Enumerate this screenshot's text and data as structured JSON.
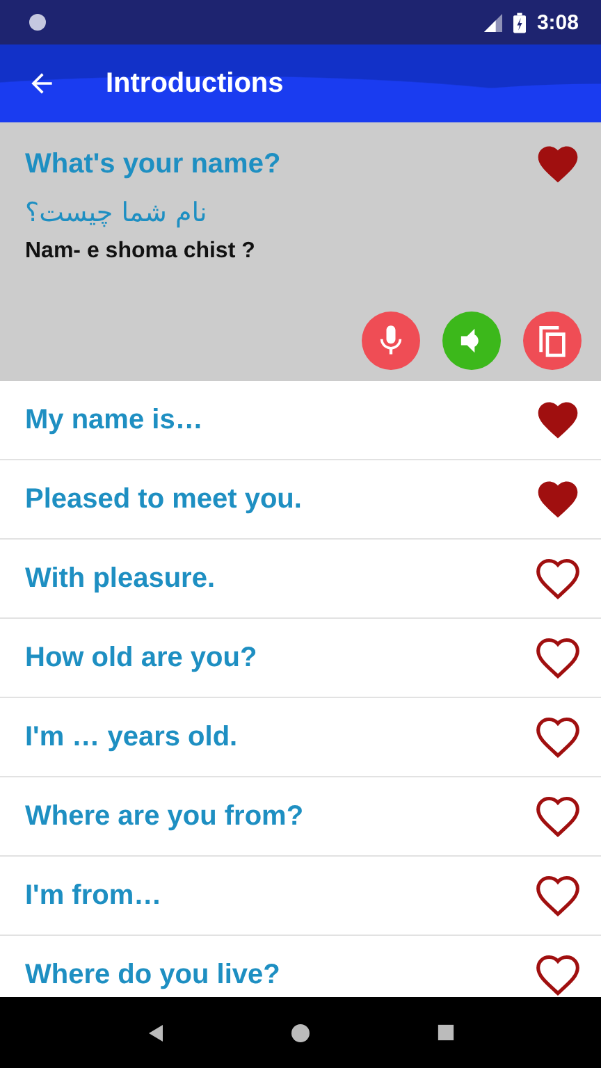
{
  "status_bar": {
    "time": "3:08"
  },
  "app_bar": {
    "title": "Introductions"
  },
  "expanded": {
    "phrase": "What's your name?",
    "translation": "نام شما چیست؟",
    "transliteration": "Nam- e shoma chist ?",
    "favorite": true
  },
  "phrases": [
    {
      "text": "My name is…",
      "favorite": true
    },
    {
      "text": "Pleased to meet you.",
      "favorite": true
    },
    {
      "text": "With pleasure.",
      "favorite": false
    },
    {
      "text": "How old are you?",
      "favorite": false
    },
    {
      "text": "I'm … years old.",
      "favorite": false
    },
    {
      "text": "Where are you from?",
      "favorite": false
    },
    {
      "text": "I'm from…",
      "favorite": false
    },
    {
      "text": "Where do you live?",
      "favorite": false
    }
  ]
}
